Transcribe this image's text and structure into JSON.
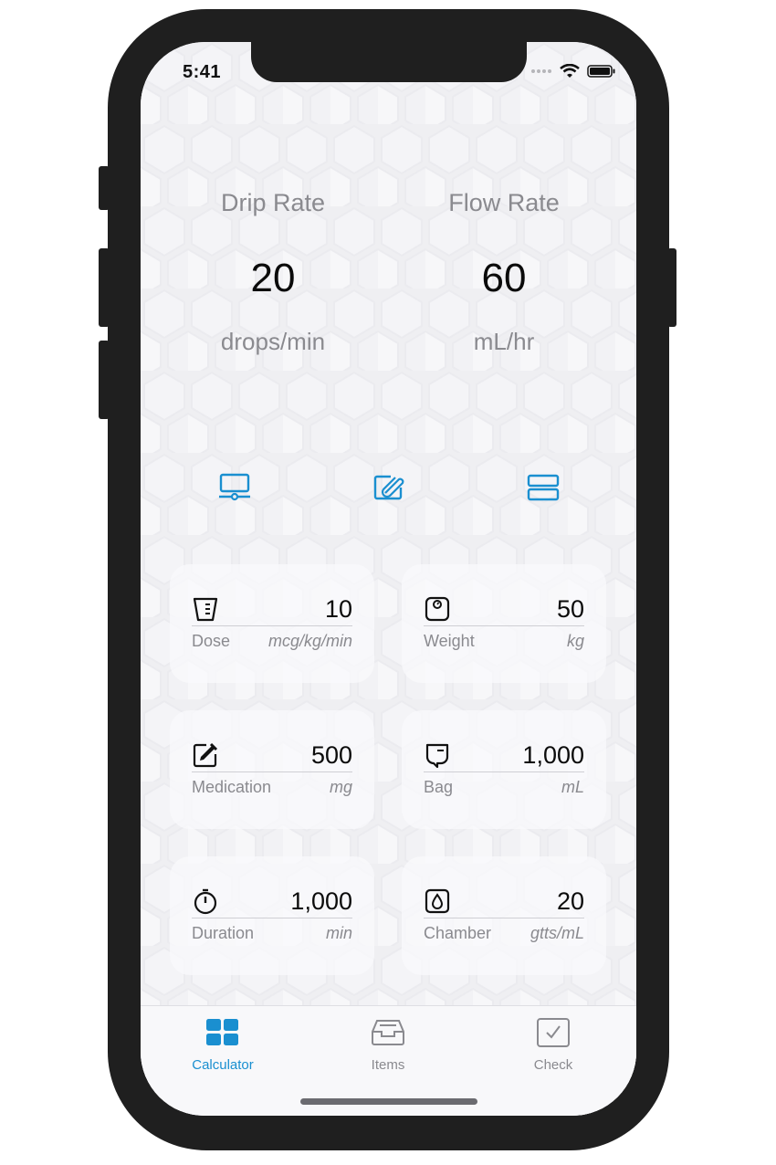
{
  "status_bar": {
    "time": "5:41"
  },
  "rates": {
    "drip": {
      "title": "Drip Rate",
      "value": "20",
      "unit": "drops/min"
    },
    "flow": {
      "title": "Flow Rate",
      "value": "60",
      "unit": "mL/hr"
    }
  },
  "mode_icons": [
    "computer-icon",
    "edit-clip-icon",
    "stacked-rows-icon"
  ],
  "cards": {
    "dose": {
      "icon": "beaker-icon",
      "value": "10",
      "label": "Dose",
      "unit": "mcg/kg/min"
    },
    "weight": {
      "icon": "scale-icon",
      "value": "50",
      "label": "Weight",
      "unit": "kg"
    },
    "medication": {
      "icon": "dropper-pencil-icon",
      "value": "500",
      "label": "Medication",
      "unit": "mg"
    },
    "bag": {
      "icon": "iv-bag-icon",
      "value": "1,000",
      "label": "Bag",
      "unit": "mL"
    },
    "duration": {
      "icon": "stopwatch-icon",
      "value": "1,000",
      "label": "Duration",
      "unit": "min"
    },
    "chamber": {
      "icon": "drop-chamber-icon",
      "value": "20",
      "label": "Chamber",
      "unit": "gtts/mL"
    }
  },
  "tabs": [
    {
      "label": "Calculator",
      "icon": "grid-icon",
      "active": true
    },
    {
      "label": "Items",
      "icon": "inbox-tray-icon",
      "active": false
    },
    {
      "label": "Check",
      "icon": "checkbox-icon",
      "active": false
    }
  ],
  "colors": {
    "accent": "#1a8fd0",
    "muted_text": "#8a8a8f",
    "value_text": "#0b0b0b",
    "frame": "#1f1f1f"
  }
}
